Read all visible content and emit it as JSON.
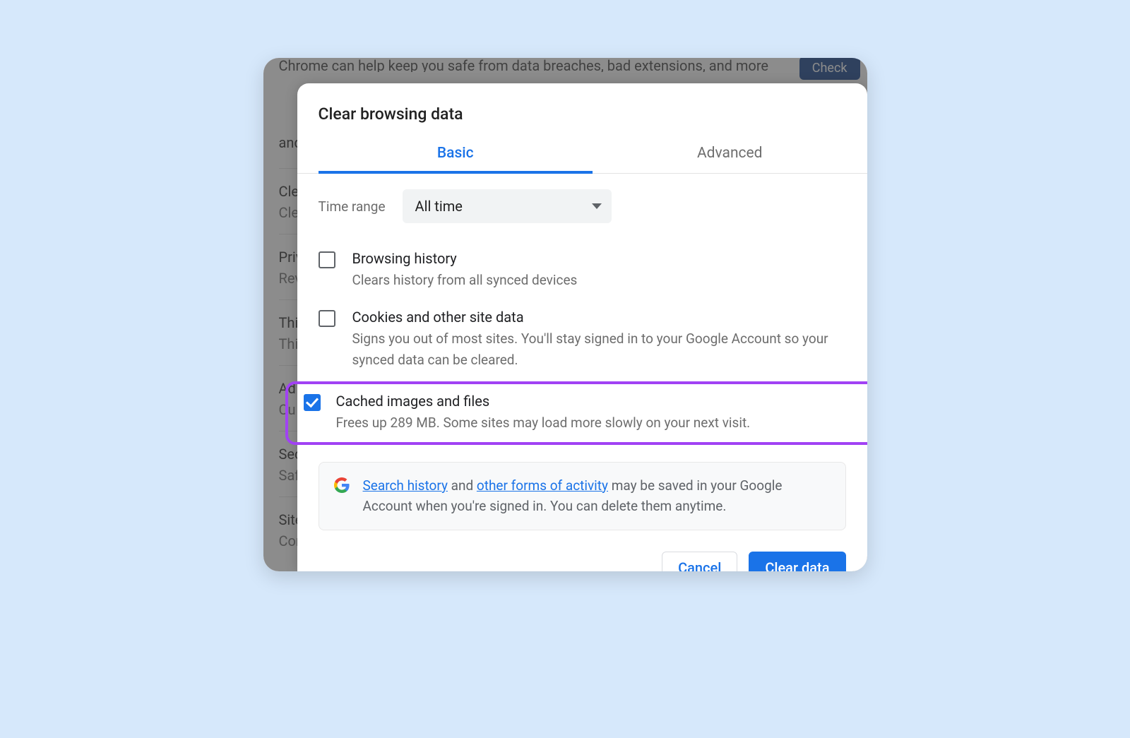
{
  "background": {
    "banner_text": "Chrome can help keep you safe from data breaches, bad extensions, and more",
    "banner_btn": "Check",
    "rows": [
      {
        "title": "and s",
        "sub": ""
      },
      {
        "title": "Clea",
        "sub": "Clea"
      },
      {
        "title": "Priva",
        "sub": "Revi"
      },
      {
        "title": "Third",
        "sub": "Third"
      },
      {
        "title": "Ad",
        "sub": "Cu"
      },
      {
        "title": "Secu",
        "sub": "Safe"
      },
      {
        "title": "Site",
        "sub": "Cont"
      }
    ]
  },
  "dialog": {
    "title": "Clear browsing data",
    "tabs": {
      "basic": "Basic",
      "advanced": "Advanced"
    },
    "time_label": "Time range",
    "time_value": "All time",
    "options": {
      "history": {
        "title": "Browsing history",
        "sub": "Clears history from all synced devices"
      },
      "cookies": {
        "title": "Cookies and other site data",
        "sub": "Signs you out of most sites. You'll stay signed in to your Google Account so your synced data can be cleared."
      },
      "cache": {
        "title": "Cached images and files",
        "sub": "Frees up 289 MB. Some sites may load more slowly on your next visit."
      }
    },
    "info": {
      "link1": "Search history",
      "mid": " and ",
      "link2": "other forms of activity",
      "rest": " may be saved in your Google Account when you're signed in. You can delete them anytime."
    },
    "buttons": {
      "cancel": "Cancel",
      "clear": "Clear data"
    }
  }
}
